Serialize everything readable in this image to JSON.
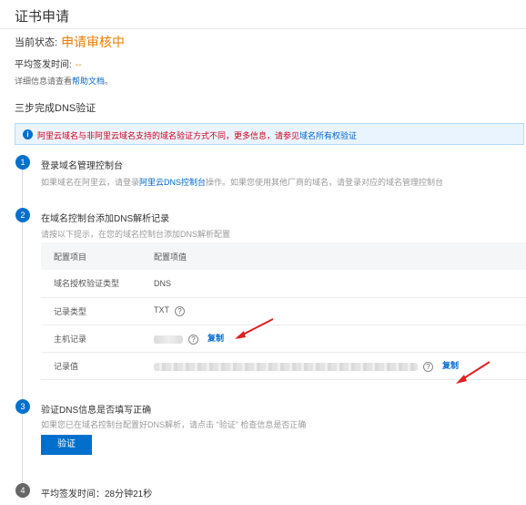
{
  "header": {
    "title": "证书申请"
  },
  "status": {
    "label": "当前状态:",
    "value": "申请审核中"
  },
  "avg_time": {
    "label": "平均签发时间:",
    "value": "--"
  },
  "help": {
    "prefix": "详细信息请查看",
    "link": "帮助文档",
    "suffix": "。"
  },
  "section": {
    "title": "三步完成DNS验证"
  },
  "notice": {
    "text": "阿里云域名与非阿里云域名支持的域名验证方式不同，更多信息，请参见",
    "link": "域名所有权验证"
  },
  "steps": [
    {
      "number": "1",
      "title": "登录域名管理控制台",
      "desc_prefix": "如果域名在阿里云，请登录",
      "desc_link": "阿里云DNS控制台",
      "desc_suffix": "操作。如果您使用其他厂商的域名，请登录对应的域名管理控制台"
    },
    {
      "number": "2",
      "title": "在域名控制台添加DNS解析记录",
      "desc": "请按以下提示，在您的域名控制台添加DNS解析配置"
    },
    {
      "number": "3",
      "title": "验证DNS信息是否填写正确",
      "desc": "如果您已在域名控制台配置好DNS解析，请点击 \"验证\" 检查信息是否正确"
    },
    {
      "number": "4",
      "title": "平均签发时间：28分钟21秒"
    }
  ],
  "table": {
    "headers": [
      "配置项目",
      "配置项值"
    ],
    "rows": [
      {
        "key": "域名授权验证类型",
        "value": "DNS"
      },
      {
        "key": "记录类型",
        "value": "TXT"
      },
      {
        "key": "主机记录",
        "value": "",
        "copy": "复制"
      },
      {
        "key": "记录值",
        "value": "",
        "copy": "复制"
      }
    ]
  },
  "verify_button": {
    "label": "验证"
  },
  "colors": {
    "accent": "#0070cc",
    "status": "#f07c00",
    "warning": "#d0021b",
    "annotation_arrow": "#e02020"
  }
}
